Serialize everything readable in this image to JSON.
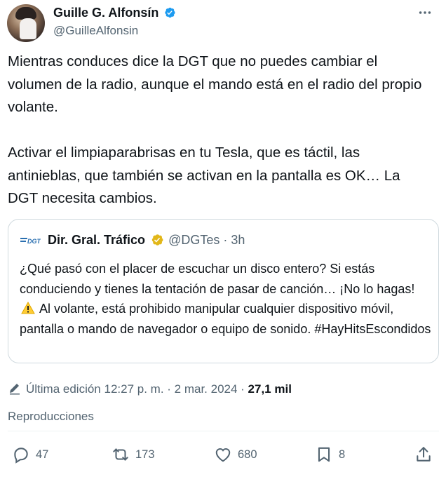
{
  "author": {
    "display_name": "Guille G. Alfonsín",
    "handle": "@GuilleAlfonsin"
  },
  "tweet": {
    "text": "Mientras conduces dice la DGT que no puedes cambiar el volumen de la radio, aunque el mando está en el radio del propio volante.\n\nActivar el limpiaparabrisas en tu Tesla, que es táctil, las antinieblas, que también se activan en la pantalla es OK… La DGT necesita cambios."
  },
  "quoted": {
    "name": "Dir. Gral. Tráfico",
    "handle_time": "@DGTes · 3h",
    "text_before_emoji": "¿Qué pasó con el placer de escuchar un disco entero? Si estás conduciendo y tienes la tentación de pasar de canción…  ¡No lo hagas!",
    "text_after_emoji": " Al volante, está prohibido manipular cualquier dispositivo móvil, pantalla o mando de navegador o equipo de sonido. #HayHitsEscondidos",
    "logo_text": "DGT"
  },
  "meta": {
    "edited": "Última edición 12:27 p. m. · 2 mar. 2024 · ",
    "views": "27,1 mil",
    "views_label": "Reproducciones"
  },
  "actions": {
    "replies": "47",
    "reposts": "173",
    "likes": "680",
    "bookmarks": "8"
  },
  "colors": {
    "text": "#0f1419",
    "secondary": "#536471",
    "verified_blue": "#1d9bf0",
    "gold": "#e2b719",
    "border": "#cfd9de"
  },
  "icons": [
    "verified-badge-icon",
    "more-icon",
    "dgt-logo",
    "gold-verified-badge-icon",
    "warning-icon",
    "edit-icon",
    "reply-icon",
    "repost-icon",
    "like-icon",
    "bookmark-icon",
    "share-icon"
  ]
}
